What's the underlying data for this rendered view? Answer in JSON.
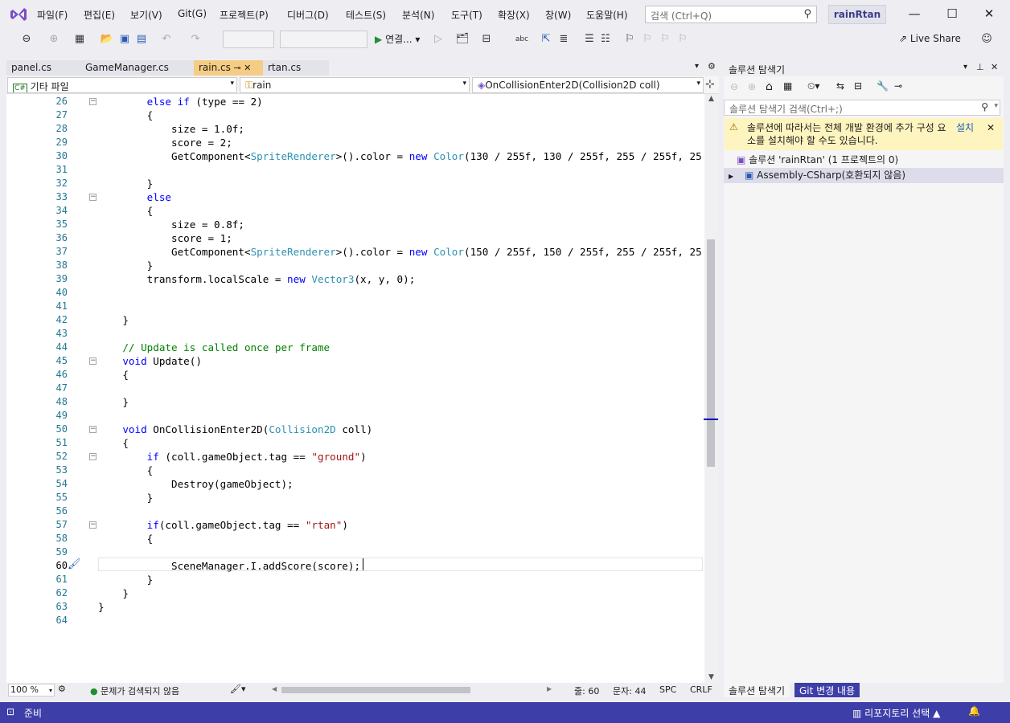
{
  "menu": [
    "파일(F)",
    "편집(E)",
    "보기(V)",
    "Git(G)",
    "프로젝트(P)",
    "디버그(D)",
    "테스트(S)",
    "분석(N)",
    "도구(T)",
    "확장(X)",
    "창(W)",
    "도움말(H)"
  ],
  "search": {
    "placeholder": "검색 (Ctrl+Q)"
  },
  "project_badge": "rainRtan",
  "toolbar": {
    "run_label": "연결...",
    "live_share": "Live Share"
  },
  "tabs": [
    {
      "label": "panel.cs",
      "active": false
    },
    {
      "label": "GameManager.cs",
      "active": false
    },
    {
      "label": "rain.cs",
      "active": true
    },
    {
      "label": "rtan.cs",
      "active": false
    }
  ],
  "nav": {
    "scope": "기타 파일",
    "class": "rain",
    "member": "OnCollisionEnter2D(Collision2D coll)"
  },
  "code": [
    {
      "n": "26",
      "t": "        else if (type == 2)"
    },
    {
      "n": "27",
      "t": "        {"
    },
    {
      "n": "28",
      "t": "            size = 1.0f;"
    },
    {
      "n": "29",
      "t": "            score = 2;"
    },
    {
      "n": "30",
      "t": "            GetComponent<SpriteRenderer>().color = new Color(130 / 255f, 130 / 255f, 255 / 255f, 25"
    },
    {
      "n": "31",
      "t": ""
    },
    {
      "n": "32",
      "t": "        }"
    },
    {
      "n": "33",
      "t": "        else"
    },
    {
      "n": "34",
      "t": "        {"
    },
    {
      "n": "35",
      "t": "            size = 0.8f;"
    },
    {
      "n": "36",
      "t": "            score = 1;"
    },
    {
      "n": "37",
      "t": "            GetComponent<SpriteRenderer>().color = new Color(150 / 255f, 150 / 255f, 255 / 255f, 25"
    },
    {
      "n": "38",
      "t": "        }"
    },
    {
      "n": "39",
      "t": "        transform.localScale = new Vector3(x, y, 0);"
    },
    {
      "n": "40",
      "t": ""
    },
    {
      "n": "41",
      "t": ""
    },
    {
      "n": "42",
      "t": "    }"
    },
    {
      "n": "43",
      "t": ""
    },
    {
      "n": "44",
      "t": "    // Update is called once per frame"
    },
    {
      "n": "45",
      "t": "    void Update()"
    },
    {
      "n": "46",
      "t": "    {"
    },
    {
      "n": "47",
      "t": ""
    },
    {
      "n": "48",
      "t": "    }"
    },
    {
      "n": "49",
      "t": ""
    },
    {
      "n": "50",
      "t": "    void OnCollisionEnter2D(Collision2D coll)"
    },
    {
      "n": "51",
      "t": "    {"
    },
    {
      "n": "52",
      "t": "        if (coll.gameObject.tag == \"ground\")"
    },
    {
      "n": "53",
      "t": "        {"
    },
    {
      "n": "54",
      "t": "            Destroy(gameObject);"
    },
    {
      "n": "55",
      "t": "        }"
    },
    {
      "n": "56",
      "t": ""
    },
    {
      "n": "57",
      "t": "        if(coll.gameObject.tag == \"rtan\")"
    },
    {
      "n": "58",
      "t": "        {"
    },
    {
      "n": "59",
      "t": ""
    },
    {
      "n": "60",
      "t": "            SceneManager.I.addScore(score);"
    },
    {
      "n": "61",
      "t": "        }"
    },
    {
      "n": "62",
      "t": "    }"
    },
    {
      "n": "63",
      "t": "}"
    },
    {
      "n": "64",
      "t": ""
    }
  ],
  "editor_status": {
    "zoom": "100 %",
    "issues": "문제가 검색되지 않음",
    "line": "줄: 60",
    "col": "문자: 44",
    "spc": "SPC",
    "crlf": "CRLF"
  },
  "solution": {
    "title": "솔루션 탐색기",
    "search_placeholder": "솔루션 탐색기 검색(Ctrl+;)",
    "warning": "솔루션에 따라서는 전체 개발 환경에 추가 구성 요소를 설치해야 할 수도 있습니다.",
    "install": "설치",
    "tree": [
      "솔루션 'rainRtan' (1 프로젝트의 0)",
      "Assembly-CSharp(호환되지 않음)"
    ],
    "bottom_tabs": [
      "솔루션 탐색기",
      "Git 변경 내용"
    ]
  },
  "status": {
    "ready": "준비",
    "repo": "리포지토리 선택"
  }
}
